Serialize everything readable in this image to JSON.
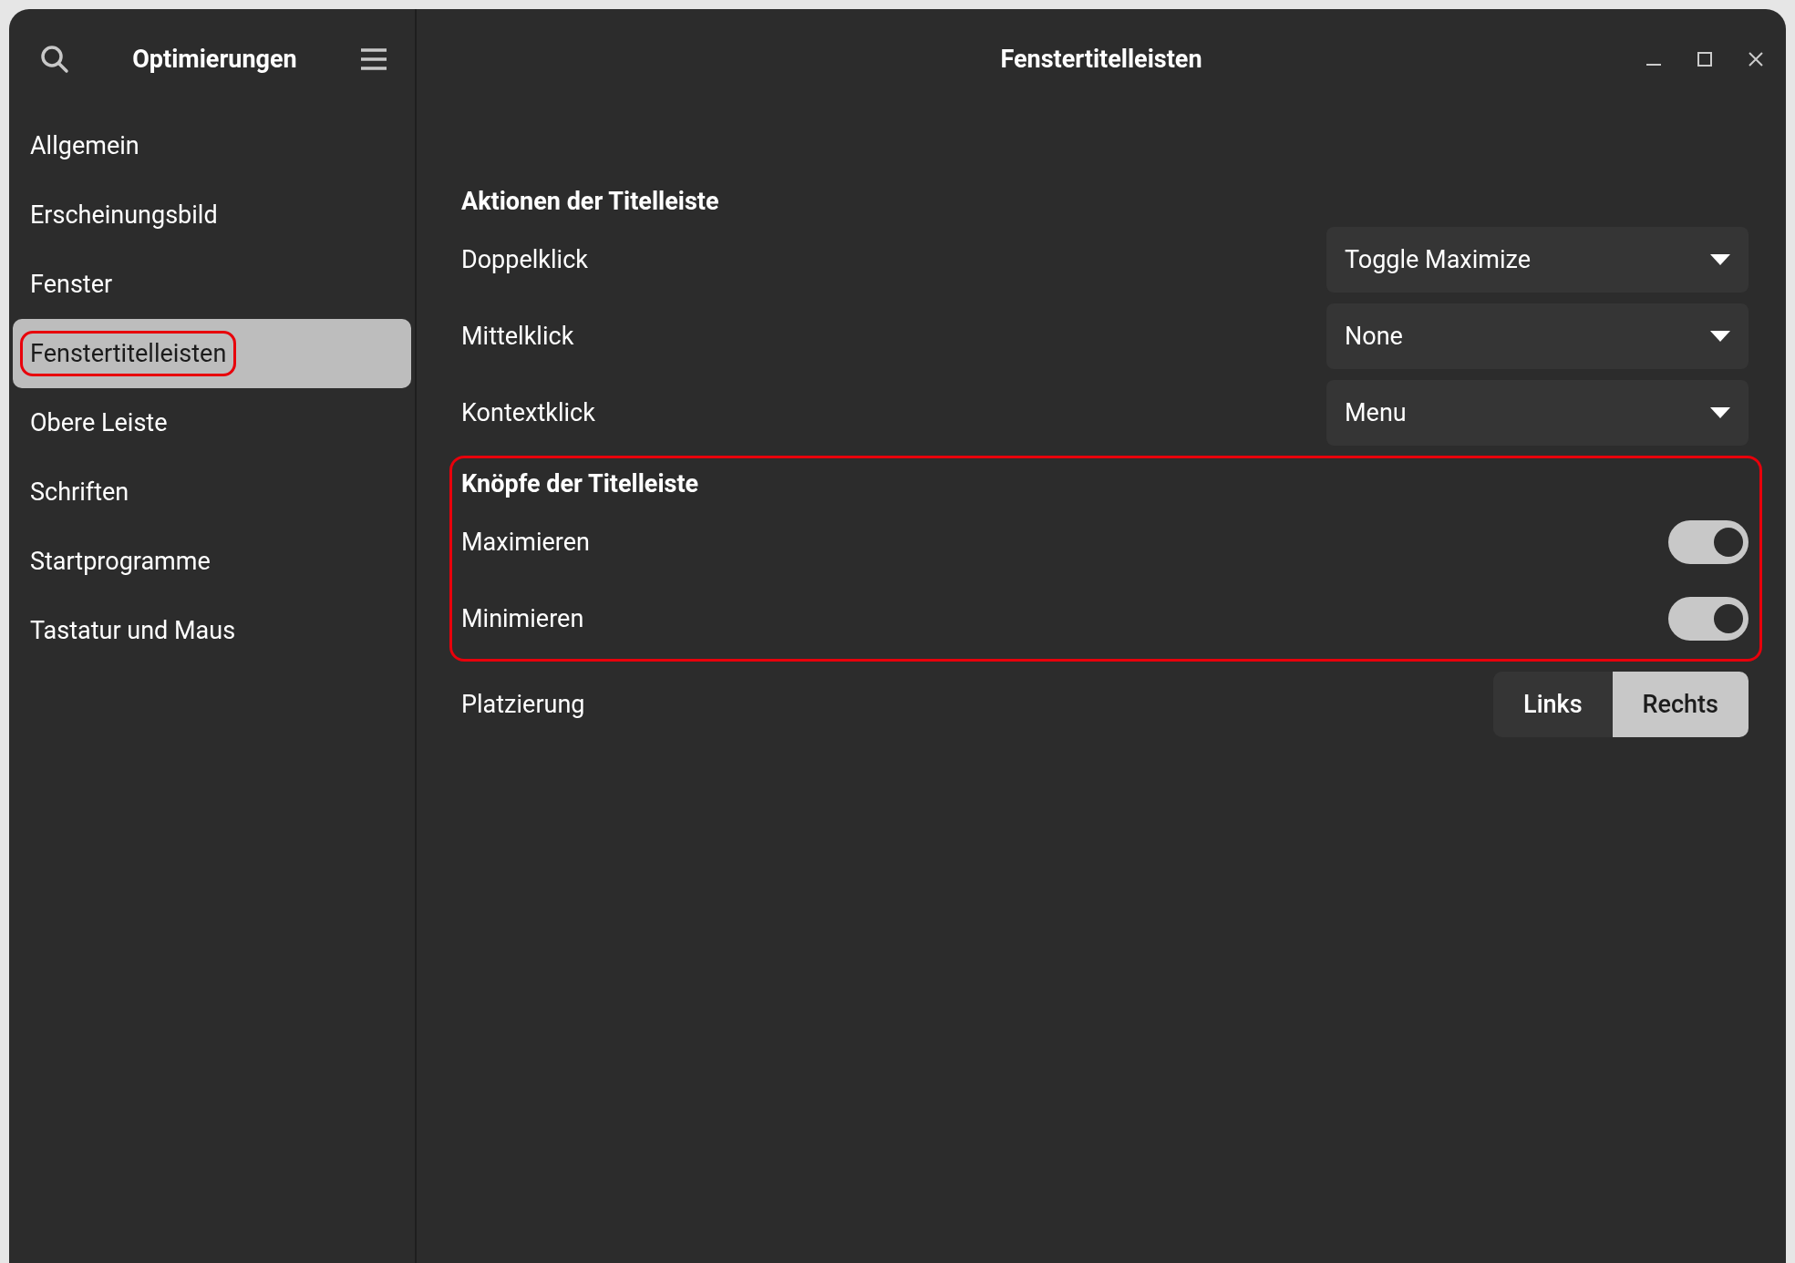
{
  "sidebar": {
    "title": "Optimierungen",
    "items": [
      {
        "label": "Allgemein",
        "selected": false,
        "highlighted": false
      },
      {
        "label": "Erscheinungsbild",
        "selected": false,
        "highlighted": false
      },
      {
        "label": "Fenster",
        "selected": false,
        "highlighted": false
      },
      {
        "label": "Fenstertitelleisten",
        "selected": true,
        "highlighted": true
      },
      {
        "label": "Obere Leiste",
        "selected": false,
        "highlighted": false
      },
      {
        "label": "Schriften",
        "selected": false,
        "highlighted": false
      },
      {
        "label": "Startprogramme",
        "selected": false,
        "highlighted": false
      },
      {
        "label": "Tastatur und Maus",
        "selected": false,
        "highlighted": false
      }
    ]
  },
  "window": {
    "title": "Fenstertitelleisten"
  },
  "sections": [
    {
      "heading": "Aktionen der Titelleiste",
      "highlighted": false,
      "rows": [
        {
          "kind": "dropdown",
          "label": "Doppelklick",
          "value": "Toggle Maximize"
        },
        {
          "kind": "dropdown",
          "label": "Mittelklick",
          "value": "None"
        },
        {
          "kind": "dropdown",
          "label": "Kontextklick",
          "value": "Menu"
        }
      ]
    },
    {
      "heading": "Knöpfe der Titelleiste",
      "highlighted": true,
      "rows": [
        {
          "kind": "switch",
          "label": "Maximieren",
          "on": true
        },
        {
          "kind": "switch",
          "label": "Minimieren",
          "on": true
        }
      ]
    },
    {
      "highlighted": false,
      "rows": [
        {
          "kind": "segmented",
          "label": "Platzierung",
          "options": [
            {
              "label": "Links",
              "selected": false
            },
            {
              "label": "Rechts",
              "selected": true
            }
          ]
        }
      ]
    }
  ]
}
